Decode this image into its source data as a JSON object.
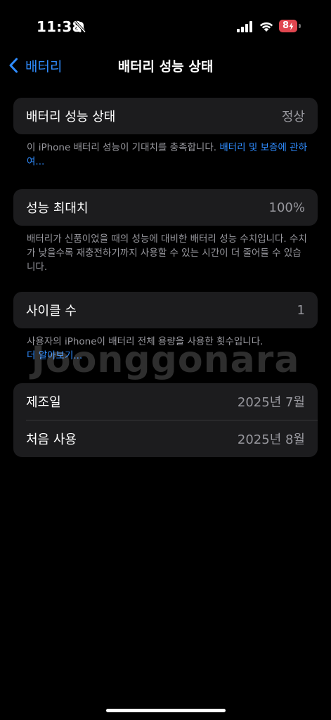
{
  "status": {
    "time": "11:38",
    "battery_level": "8"
  },
  "nav": {
    "back_label": "배터리",
    "title": "배터리 성능 상태"
  },
  "health": {
    "label": "배터리 성능 상태",
    "value": "정상",
    "note_text": "이 iPhone 배터리 성능이 기대치를 충족합니다.",
    "note_link": "배터리 및 보증에 관하여..."
  },
  "max_capacity": {
    "label": "성능 최대치",
    "value": "100%",
    "note": "배터리가 신품이었을 때의 성능에 대비한 배터리 성능 수치입니다. 수치가 낮을수록 재충전하기까지 사용할 수 있는 시간이 더 줄어들 수 있습니다."
  },
  "cycle": {
    "label": "사이클 수",
    "value": "1",
    "note_text": "사용자의 iPhone이 배터리 전체 용량을 사용한 횟수입니다.",
    "note_link": "더 알아보기..."
  },
  "dates": {
    "manufacture_label": "제조일",
    "manufacture_value": "2025년 7월",
    "first_use_label": "처음 사용",
    "first_use_value": "2025년 8월"
  },
  "watermark": "Joonggonara",
  "colors": {
    "accent": "#2f8cff",
    "battery_low": "#e0464f",
    "cell_bg": "#1c1c1e"
  }
}
